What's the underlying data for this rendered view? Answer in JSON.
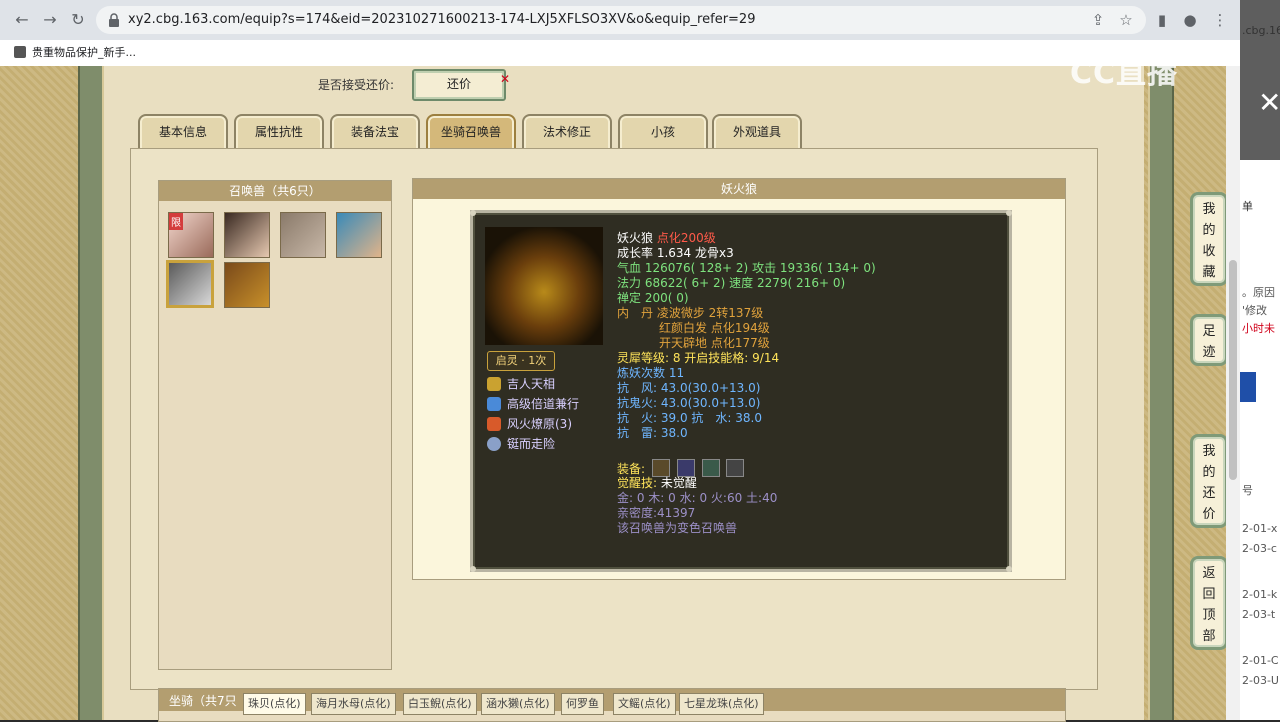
{
  "browser": {
    "url": "xy2.cbg.163.com/equip?s=174&eid=202310271600213-174-LXJ5XFLSO3XV&o&equip_refer=29",
    "bookmark_label": "贵重物品保护_新手..."
  },
  "offer": {
    "label": "是否接受还价:",
    "button": "还价"
  },
  "tabs": [
    "基本信息",
    "属性抗性",
    "装备法宝",
    "坐骑召唤兽",
    "法术修正",
    "小孩",
    "外观道具"
  ],
  "pets": {
    "header": "召唤兽（共6只）",
    "badge": "限"
  },
  "detail": {
    "header": "妖火狼",
    "name": "妖火狼",
    "level": "点化200级",
    "growth": "成长率 1.634 龙骨x3",
    "hp_label": "气血",
    "hp_value": "126076( 128+ 2)",
    "atk_label": "攻击",
    "atk_value": "19336( 134+ 0)",
    "mp_label": "法力",
    "mp_value": "68622( 6+ 2)",
    "spd_label": "速度",
    "spd_value": "2279( 216+ 0)",
    "zen_label": "禅定",
    "zen_value": "200( 0)",
    "dan_label": "内　丹",
    "dan1": "凌波微步 2转137级",
    "dan2": "红颜白发 点化194级",
    "dan3": "开天辟地 点化177级",
    "lingxi": "灵犀等级: 8  开启技能格: 9/14",
    "lianyao": "炼妖次数 11",
    "res_wind": "抗　风: 43.0(30.0+13.0)",
    "res_ghostfire": "抗鬼火: 43.0(30.0+13.0)",
    "res_fire_water": "抗　火: 39.0  抗　水: 38.0",
    "res_thunder": "抗　雷: 38.0",
    "equip_label": "装备:",
    "awaken_label": "觉醒技:",
    "awaken_value": "未觉醒",
    "elements": "金: 0  木: 0  水: 0  火:60  土:40",
    "intimacy": "亲密度:41397",
    "note": "该召唤兽为变色召唤兽",
    "qiling": "启灵 · 1次",
    "skills": [
      "吉人天相",
      "高级倍道兼行",
      "风火燎原(3)",
      "铤而走险"
    ]
  },
  "mount": {
    "title": "坐骑（共7只",
    "tabs": [
      "珠贝(点化)",
      "海月水母(点化)",
      "白玉鲵(点化)",
      "涵水獭(点化)",
      "何罗鱼",
      "文鳐(点化)",
      "七星龙珠(点化)"
    ]
  },
  "side_buttons": [
    [
      "我",
      "的",
      "收",
      "藏"
    ],
    [
      "足",
      "迹"
    ],
    [
      "我",
      "的",
      "还",
      "价"
    ],
    [
      "返",
      "回",
      "顶",
      "部"
    ]
  ],
  "right_panel": {
    "tab_text": ".cbg.16",
    "watermark": "CC直播",
    "fragments": [
      "单",
      "。原因",
      "'修改",
      "小时未",
      "号",
      "2-01-x",
      "2-03-c",
      "2-01-k",
      "2-03-t",
      "2-01-C",
      "2-03-U"
    ]
  }
}
